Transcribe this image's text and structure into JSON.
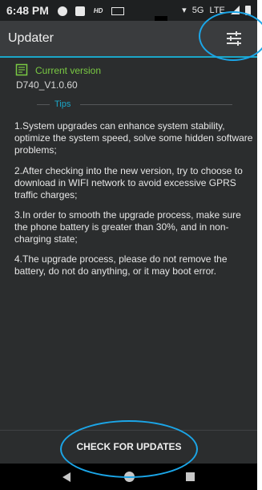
{
  "status_bar": {
    "time": "6:48 PM",
    "hd_label": "HD",
    "network": "5G",
    "network_type": "LTE"
  },
  "app_bar": {
    "title": "Updater",
    "settings_icon": "tune-icon"
  },
  "version": {
    "label": "Current version",
    "value": "D740_V1.0.60",
    "icon": "document-icon"
  },
  "tips": {
    "heading": "Tips",
    "items": [
      "1.System upgrades can enhance system stability, optimize the system speed, solve some hidden software problems;",
      "2.After checking into the new version, try to choose to download in WIFI network to avoid excessive GPRS traffic charges;",
      "3.In order to smooth the upgrade process, make sure the phone battery is greater than 30%, and in non-charging state;",
      "4.The upgrade process, please do not remove the battery, do not do anything, or it may boot error."
    ]
  },
  "action": {
    "check_label": "CHECK FOR UPDATES"
  },
  "colors": {
    "accent": "#1ba6c8",
    "version_green": "#7ac943",
    "highlight_ring": "#1ba6e8",
    "background": "#2b2d2e"
  }
}
